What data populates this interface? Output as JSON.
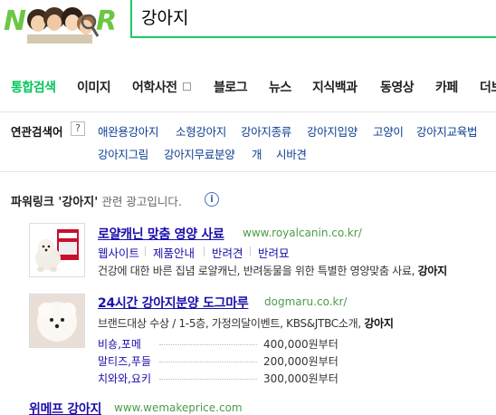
{
  "header": {
    "logo_text": "NAVER",
    "search_value": "강아지"
  },
  "tabs": [
    {
      "label": "통합검색"
    },
    {
      "label": "이미지"
    },
    {
      "label": "어학사전"
    },
    {
      "label": "블로그"
    },
    {
      "label": "뉴스"
    },
    {
      "label": "지식백과"
    },
    {
      "label": "동영상"
    },
    {
      "label": "카페"
    },
    {
      "label": "더보"
    }
  ],
  "related": {
    "title": "연관검색어",
    "help": "?",
    "items": [
      {
        "label": "애완용강아지"
      },
      {
        "label": "소형강아지"
      },
      {
        "label": "강아지종류"
      },
      {
        "label": "강아지입양"
      },
      {
        "label": "고양이"
      },
      {
        "label": "강아지교육법"
      },
      {
        "label": "강아지그림"
      },
      {
        "label": "강아지무료분양"
      },
      {
        "label": "개"
      },
      {
        "label": "시바견"
      }
    ]
  },
  "power_link": {
    "title_prefix": "파워링크 '",
    "keyword": "강아지",
    "title_suffix": "'",
    "subtitle": "관련 광고입니다.",
    "info": "i"
  },
  "ads": [
    {
      "title": "로얄캐닌 맞춤 영양 사료",
      "url": "www.royalcanin.co.kr/",
      "links": [
        "웹사이트",
        "제품안내",
        "반려견",
        "반려묘"
      ],
      "desc": "건강에 대한 바른 집념 로얄캐닌, 반려동물을 위한 특별한 영양맞춤 사료,",
      "desc_keyword": "강아지"
    },
    {
      "title": "24시간 강아지분양 도그마루",
      "url": "dogmaru.co.kr/",
      "desc": "브랜드대상 수상 / 1-5층, 가정의달이벤트, KBS&JTBC소개,",
      "desc_keyword": "강아지",
      "prices": [
        {
          "name": "비숑,포메",
          "value": "400,000원부터"
        },
        {
          "name": "말티즈,푸들",
          "value": "200,000원부터"
        },
        {
          "name": "치와와,요키",
          "value": "300,000원부터"
        }
      ]
    },
    {
      "title": "위메프 강아지",
      "url": "www.wemakeprice.com"
    }
  ]
}
